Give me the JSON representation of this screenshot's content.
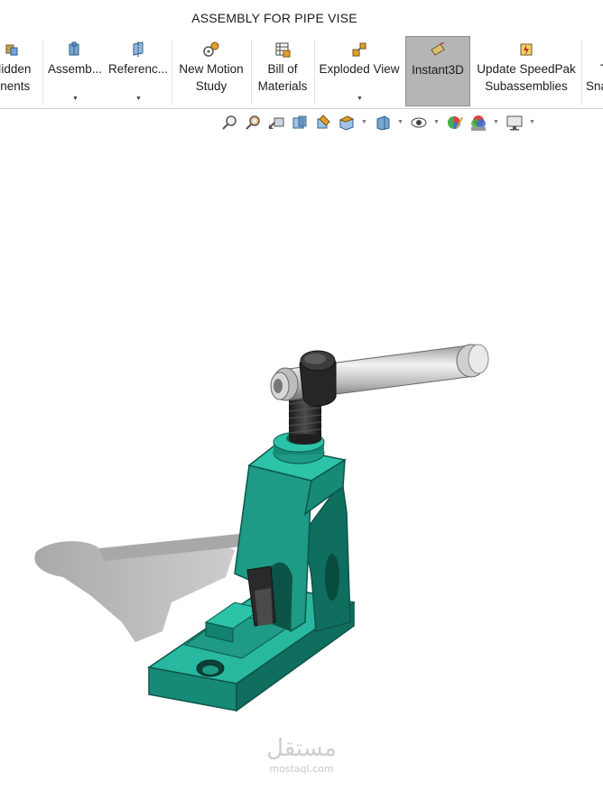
{
  "window": {
    "title": "ASSEMBLY FOR PIPE VISE"
  },
  "ribbon": {
    "hidden_components": {
      "line1": "Hidden",
      "line2": "onents"
    },
    "assembly": {
      "label": "Assemb..."
    },
    "reference": {
      "label": "Referenc..."
    },
    "new_motion_study": {
      "line1": "New Motion",
      "line2": "Study"
    },
    "bill_of_materials": {
      "line1": "Bill of",
      "line2": "Materials"
    },
    "exploded_view": {
      "label": "Exploded View"
    },
    "instant3d": {
      "label": "Instant3D",
      "active": true
    },
    "update_speedpak": {
      "line1": "Update SpeedPak",
      "line2": "Subassemblies"
    },
    "snapshot": {
      "line1": "T",
      "line2": "Sna"
    }
  },
  "view_toolbar": {
    "icons": [
      "zoom-to-fit-icon",
      "zoom-to-area-icon",
      "previous-view-icon",
      "section-view-icon",
      "dynamic-annotation-icon",
      "view-orientation-icon",
      "display-style-icon",
      "hide-show-items-icon",
      "edit-appearance-icon",
      "apply-scene-icon",
      "view-settings-icon"
    ]
  },
  "model": {
    "name": "pipe vise assembly",
    "body_color": "#1e9a86",
    "handle_color": "#d0d0d0",
    "screw_color": "#2a2a2a"
  },
  "watermark": {
    "arabic": "مستقل",
    "latin": "mostaql.com"
  },
  "colors": {
    "active_button": "#b5b5b5",
    "ribbon_bg": "#ffffff"
  }
}
